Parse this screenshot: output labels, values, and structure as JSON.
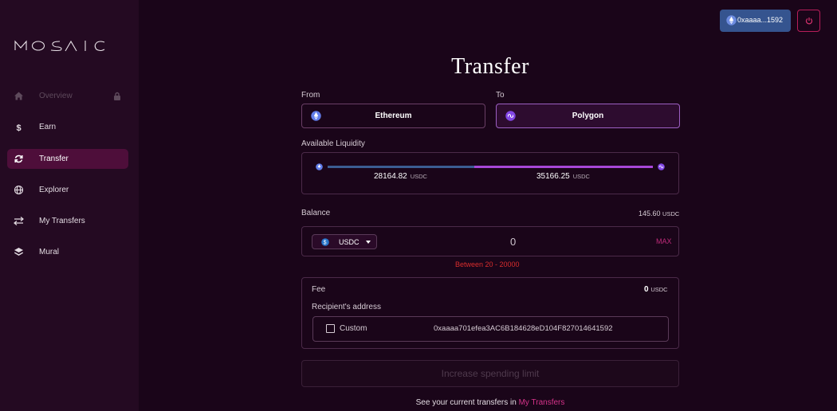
{
  "app": {
    "logo_text": "MOSAIC"
  },
  "sidebar": {
    "items": [
      {
        "label": "Overview",
        "icon": "home-icon",
        "state": "disabled"
      },
      {
        "label": "Earn",
        "icon": "dollar-icon",
        "state": "normal"
      },
      {
        "label": "Transfer",
        "icon": "refresh-icon",
        "state": "active"
      },
      {
        "label": "Explorer",
        "icon": "globe-icon",
        "state": "normal"
      },
      {
        "label": "My Transfers",
        "icon": "swap-arrows-icon",
        "state": "normal"
      },
      {
        "label": "Mural",
        "icon": "layers-icon",
        "state": "normal"
      }
    ]
  },
  "header": {
    "wallet_address": "0xaaaa...1592",
    "wallet_icon": "ethereum-icon",
    "power_icon": "power-icon"
  },
  "transfer": {
    "title": "Transfer",
    "from_label": "From",
    "to_label": "To",
    "from_chain": "Ethereum",
    "to_chain": "Polygon",
    "liquidity_label": "Available Liquidity",
    "liquidity_from_value": "28164.82",
    "liquidity_to_value": "35166.25",
    "liquidity_unit": "USDC",
    "balance_label": "Balance",
    "balance_value": "145.60",
    "balance_unit": "USDC",
    "token": "USDC",
    "amount": "0",
    "max_label": "MAX",
    "error_text": "Between 20 - 20000",
    "fee_label": "Fee",
    "fee_value": "0",
    "fee_unit": "USDC",
    "recipient_label": "Recipient's address",
    "custom_label": "Custom",
    "recipient_address": "0xaaaa701efea3AC6B184628eD104F827014641592",
    "submit_label": "Increase spending limit",
    "footer_text": "See your current transfers in",
    "footer_link": "My Transfers"
  },
  "colors": {
    "background": "#1a0519",
    "sidebar": "#240a22",
    "accent_pink": "#c02b7a",
    "wallet_blue": "#35548f",
    "polygon_purple": "#a847d8",
    "error_red": "#d92d2d"
  }
}
